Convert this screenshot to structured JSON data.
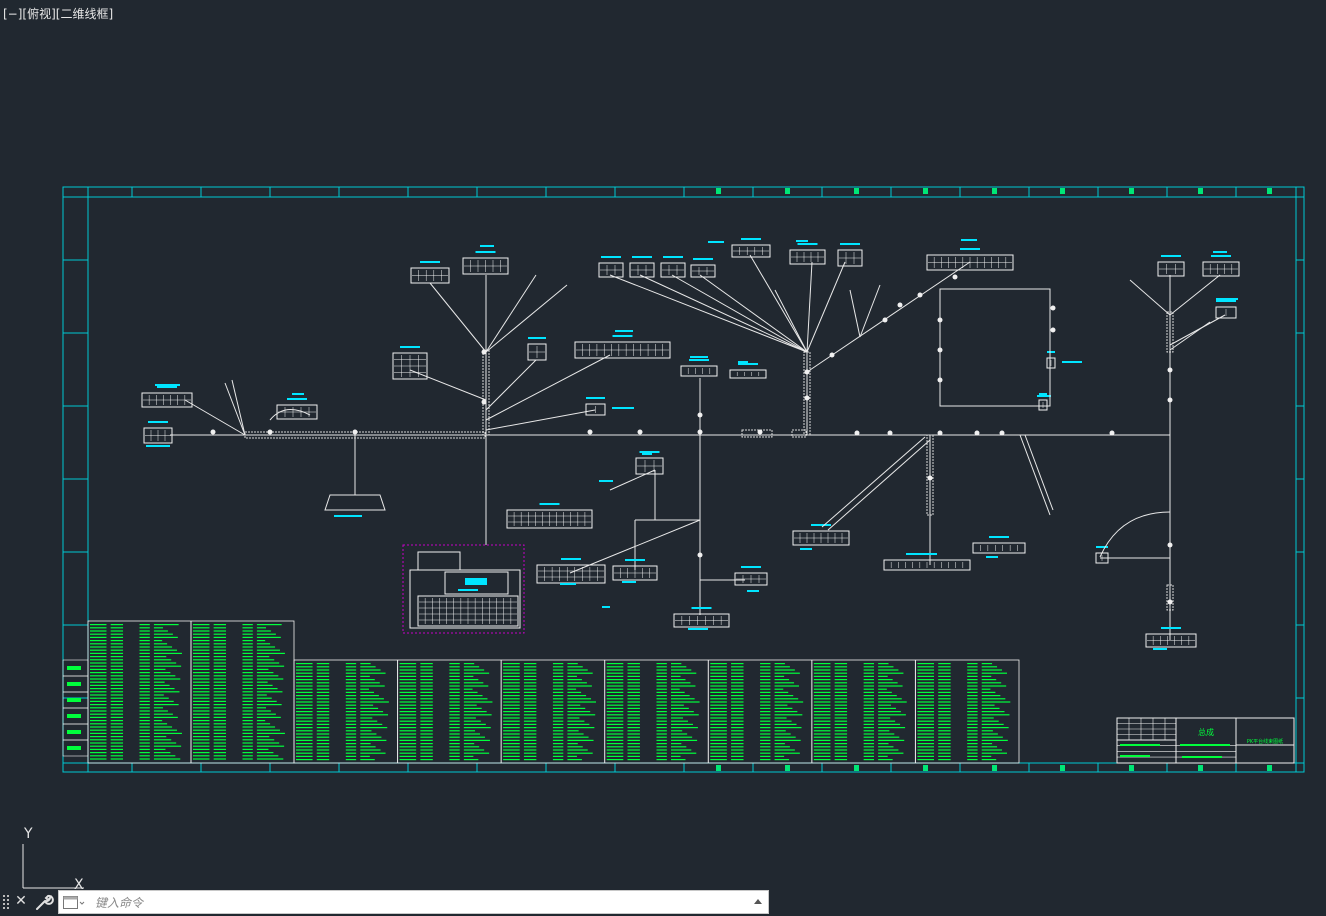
{
  "viewport": {
    "label": "[−][俯视][二维线框]"
  },
  "drawing": {
    "title_block": {
      "title": "总成",
      "drawing_name": "PK平台线束图纸"
    },
    "colors": {
      "background": "#212830",
      "frame": "#00c8d2",
      "line": "#ffffff",
      "label": "#00e5ff",
      "table": "#00ff3c",
      "selection": "#c800c8"
    }
  },
  "ucs": {
    "y_label": "Y",
    "x_label": "X"
  },
  "command_line": {
    "placeholder": "键入命令",
    "value": "",
    "icons": [
      "grip-icon",
      "close-icon",
      "wrench-icon",
      "terminal-icon",
      "chevron-up-icon"
    ]
  }
}
